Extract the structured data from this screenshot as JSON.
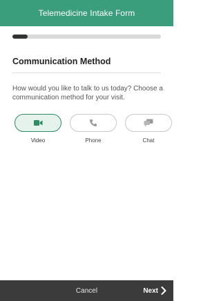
{
  "header": {
    "title": "Telemedicine Intake Form"
  },
  "progress": {
    "fraction": 0.1
  },
  "section": {
    "title": "Communication Method",
    "prompt": "How would you like to talk to us today? Choose a communication method for your visit."
  },
  "methods": [
    {
      "label": "Video",
      "icon": "video-camera-icon",
      "selected": true
    },
    {
      "label": "Phone",
      "icon": "phone-icon",
      "selected": false
    },
    {
      "label": "Chat",
      "icon": "chat-icon",
      "selected": false
    }
  ],
  "footer": {
    "cancel_label": "Cancel",
    "next_label": "Next"
  },
  "colors": {
    "accent": "#3a9d7c",
    "selected": "#2e8b63",
    "footer_bg": "#3b3b3b"
  }
}
